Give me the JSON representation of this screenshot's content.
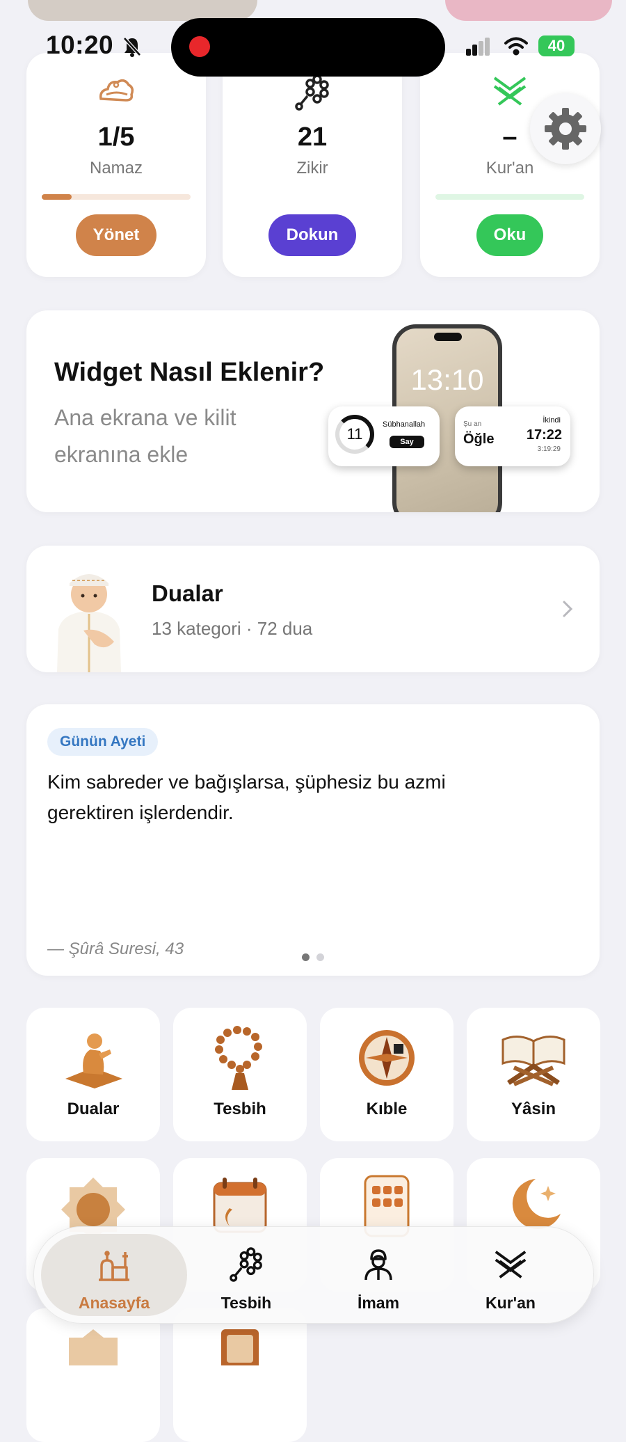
{
  "status_bar": {
    "time": "10:20",
    "battery": "40"
  },
  "stats": [
    {
      "value": "1/5",
      "label": "Namaz",
      "button": "Yönet",
      "accent": "#d0834a",
      "track": "#f6e7dc",
      "progress": 0.2
    },
    {
      "value": "21",
      "label": "Zikir",
      "button": "Dokun",
      "accent": "#5a40d2",
      "progress": null
    },
    {
      "value": "–",
      "label": "Kur'an",
      "button": "Oku",
      "accent": "#34c759",
      "track": "#dff6e4",
      "progress": 0
    }
  ],
  "widget_card": {
    "title": "Widget Nasıl Eklenir?",
    "subtitle": "Ana ekrana ve kilit ekranına ekle",
    "phone_time": "13:10",
    "counter_value": "11",
    "counter_label": "Sübhanallah",
    "counter_button": "Say",
    "prayer_now_label": "Şu an",
    "prayer_now": "Öğle",
    "prayer_next_label": "İkindi",
    "prayer_next_time": "17:22",
    "prayer_countdown": "3:19:29"
  },
  "duas_card": {
    "title": "Dualar",
    "subtitle": "13 kategori · 72 dua"
  },
  "verse_card": {
    "tag": "Günün Ayeti",
    "text": "Kim sabreder ve bağışlarsa, şüphesiz bu azmi gerektiren işlerdendir.",
    "reference": "— Şûrâ Suresi, 43",
    "page_index": 0,
    "page_count": 2
  },
  "grid_row1": [
    {
      "label": "Dualar",
      "icon": "praying-figure-icon"
    },
    {
      "label": "Tesbih",
      "icon": "prayer-beads-icon"
    },
    {
      "label": "Kıble",
      "icon": "compass-icon"
    },
    {
      "label": "Yâsin",
      "icon": "quran-book-icon"
    }
  ],
  "grid_row2": [
    {
      "icon": "allah-calligraphy-icon"
    },
    {
      "icon": "calendar-icon"
    },
    {
      "icon": "phone-apps-icon"
    },
    {
      "icon": "crescent-moon-icon"
    }
  ],
  "tabs": [
    {
      "label": "Anasayfa",
      "icon": "mosque-icon",
      "active": true,
      "color": "#c97b42"
    },
    {
      "label": "Tesbih",
      "icon": "prayer-beads-icon",
      "active": false,
      "color": "#111111"
    },
    {
      "label": "İmam",
      "icon": "imam-icon",
      "active": false,
      "color": "#111111"
    },
    {
      "label": "Kur'an",
      "icon": "quran-icon",
      "active": false,
      "color": "#111111"
    }
  ]
}
